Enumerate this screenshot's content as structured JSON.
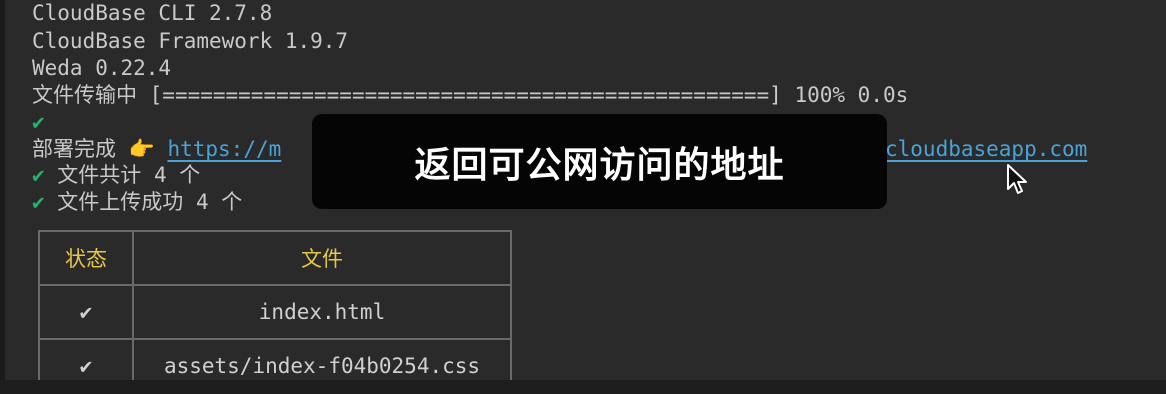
{
  "terminal": {
    "lines": {
      "cli_version": "CloudBase CLI 2.7.8",
      "framework_version": "CloudBase Framework 1.9.7",
      "weda_version": "Weda 0.22.4",
      "transfer_label": "文件传输中 ",
      "transfer_bar": "[================================================]",
      "transfer_stats": " 100% 0.0s",
      "check_mark": "✔",
      "deploy_label": "部署完成 ",
      "deploy_pointer": "👉",
      "url_visible_start": "https://m",
      "url_visible_end": "cloudbaseapp.com",
      "files_total": " 文件共计 4 个",
      "files_uploaded": " 文件上传成功 4 个"
    },
    "table": {
      "headers": [
        "状态",
        "文件"
      ],
      "rows": [
        {
          "status": "✔",
          "file": "index.html"
        },
        {
          "status": "✔",
          "file": "assets/index-f04b0254.css"
        }
      ]
    }
  },
  "caption": {
    "text": "返回可公网访问的地址"
  },
  "colors": {
    "background": "#2a2a2a",
    "check": "#21b56b",
    "link": "#4aa3d8",
    "table_header": "#e6c84a",
    "caption_bg": "#050505"
  },
  "icons": {
    "cursor": "mouse-pointer-icon",
    "pointer": "pointing-hand-emoji"
  }
}
